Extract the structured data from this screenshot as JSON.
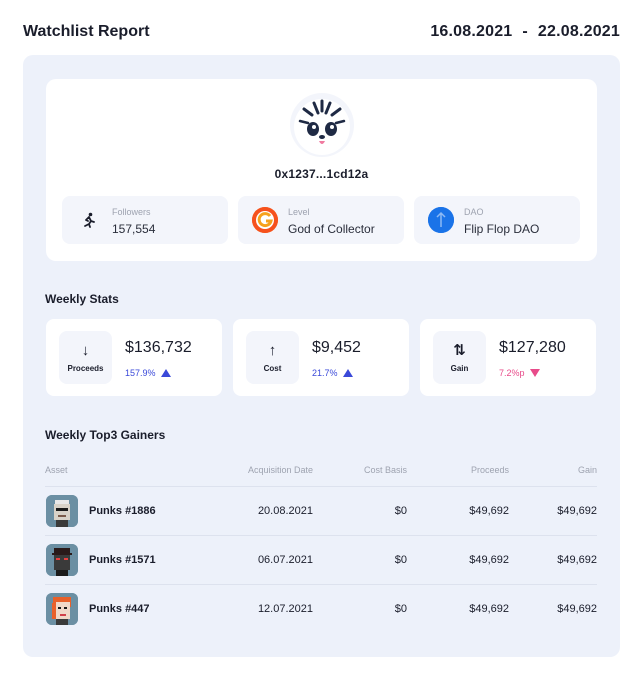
{
  "header": {
    "title": "Watchlist Report",
    "date_from": "16.08.2021",
    "date_sep": "-",
    "date_to": "22.08.2021"
  },
  "profile": {
    "address": "0x1237...1cd12a",
    "followers": {
      "label": "Followers",
      "value": "157,554",
      "icon": "runner-icon"
    },
    "level": {
      "label": "Level",
      "value": "God of Collector",
      "icon": "level-logo-icon",
      "color": "#f5771f"
    },
    "dao": {
      "label": "DAO",
      "value": "Flip Flop DAO",
      "icon": "dao-logo-icon",
      "color": "#1a73e8"
    }
  },
  "weekly_stats": {
    "title": "Weekly Stats",
    "cards": [
      {
        "label": "Proceeds",
        "amount": "$136,732",
        "change": "157.9%",
        "direction": "up",
        "icon": "arrow-down-icon"
      },
      {
        "label": "Cost",
        "amount": "$9,452",
        "change": "21.7%",
        "direction": "up",
        "icon": "arrow-up-icon"
      },
      {
        "label": "Gain",
        "amount": "$127,280",
        "change": "7.2%p",
        "direction": "down",
        "icon": "swap-vertical-icon"
      }
    ]
  },
  "top_gainers": {
    "title": "Weekly Top3 Gainers",
    "columns": [
      "Asset",
      "Acquisition Date",
      "Cost Basis",
      "Proceeds",
      "Gain"
    ],
    "rows": [
      {
        "asset": "Punks  #1886",
        "acquisition_date": "20.08.2021",
        "cost_basis": "$0",
        "proceeds": "$49,692",
        "gain": "$49,692"
      },
      {
        "asset": "Punks  #1571",
        "acquisition_date": "06.07.2021",
        "cost_basis": "$0",
        "proceeds": "$49,692",
        "gain": "$49,692"
      },
      {
        "asset": "Punks  #447",
        "acquisition_date": "12.07.2021",
        "cost_basis": "$0",
        "proceeds": "$49,692",
        "gain": "$49,692"
      }
    ]
  },
  "colors": {
    "panel_bg": "#edf1fa",
    "up": "#3a49d9",
    "down": "#e84b8a"
  }
}
